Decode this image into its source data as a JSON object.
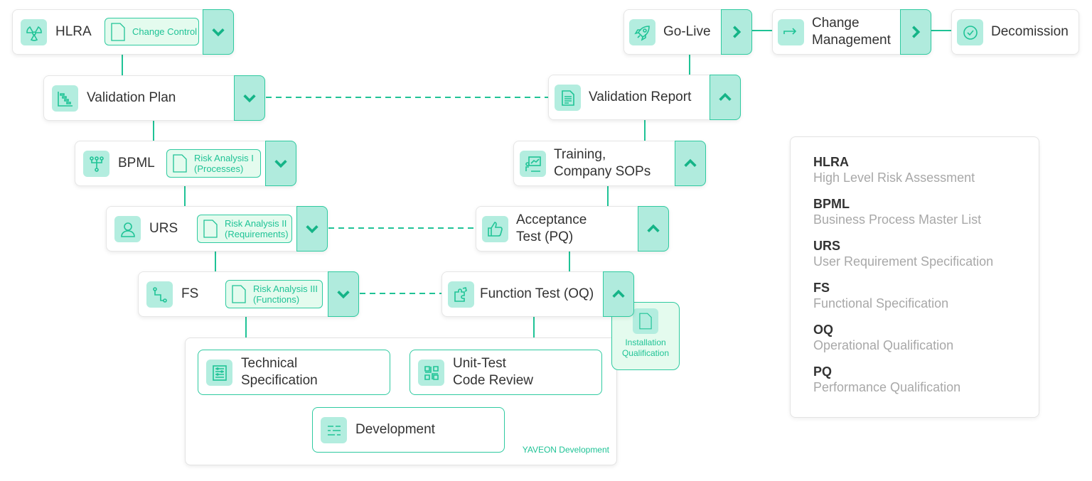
{
  "colors": {
    "accent": "#1fc396",
    "button": "#b0ebdd",
    "document": "#e4fbee"
  },
  "left": [
    {
      "label": "HLRA",
      "icon": "radiation-icon",
      "doc": "Change Control",
      "button": "chevron-down"
    },
    {
      "label": "Validation Plan",
      "icon": "gantt-chart-icon",
      "button": "chevron-down"
    },
    {
      "label": "BPML",
      "icon": "process-tree-icon",
      "doc1": "Risk Analysis I",
      "doc2": "(Processes)",
      "button": "chevron-down"
    },
    {
      "label": "URS",
      "icon": "user-icon",
      "doc1": "Risk Analysis II",
      "doc2": "(Requirements)",
      "button": "chevron-down"
    },
    {
      "label": "FS",
      "icon": "flow-icon",
      "doc1": "Risk Analysis III",
      "doc2": "(Functions)",
      "button": "chevron-down"
    }
  ],
  "right": [
    {
      "label": "Validation Report",
      "icon": "report-icon",
      "button": "chevron-up"
    },
    {
      "label1": "Training,",
      "label2": "Company SOPs",
      "icon": "presentation-icon",
      "button": "chevron-up"
    },
    {
      "label1": "Acceptance",
      "label2": "Test (PQ)",
      "icon": "thumbs-up-icon",
      "button": "chevron-up"
    },
    {
      "label": "Function Test (OQ)",
      "icon": "puzzle-icon",
      "button": "chevron-up"
    }
  ],
  "top": [
    {
      "label": "Go-Live",
      "icon": "rocket-icon",
      "button": "chevron-right"
    },
    {
      "label1": "Change",
      "label2": "Management",
      "icon": "arrow-turn-icon",
      "button": "chevron-right"
    },
    {
      "label": "Decomission",
      "icon": "check-circle-icon"
    }
  ],
  "iq": {
    "label1": "Installation",
    "label2": "Qualification"
  },
  "dev": {
    "title": "YAVEON Development",
    "tech1": "Technical",
    "tech2": "Specification",
    "unit1": "Unit-Test",
    "unit2": "Code Review",
    "development": "Development"
  },
  "legend": [
    {
      "abbr": "HLRA",
      "full": "High Level Risk Assessment"
    },
    {
      "abbr": "BPML",
      "full": "Business Process Master List"
    },
    {
      "abbr": "URS",
      "full": "User Requirement Specification"
    },
    {
      "abbr": "FS",
      "full": "Functional Specification"
    },
    {
      "abbr": "OQ",
      "full": "Operational Qualification"
    },
    {
      "abbr": "PQ",
      "full": "Performance Qualification"
    }
  ]
}
